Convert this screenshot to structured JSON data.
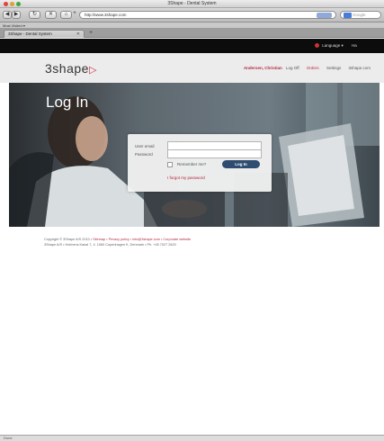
{
  "window": {
    "title": "3Shape - Dental System"
  },
  "toolbar": {
    "back": "◀",
    "forward": "▶",
    "reload": "↻",
    "stop": "✕",
    "home": "⌂",
    "add": "+",
    "url": "http://www.3shape.com",
    "search_placeholder": "Google"
  },
  "bookmarks": {
    "label": "Most Visited ▾"
  },
  "tabs": [
    {
      "label": "3Shape - Dental System"
    }
  ],
  "top_strip": {
    "language": "Language ▾",
    "help": "Ha"
  },
  "header": {
    "logo_text": "3shape",
    "logo_mark": "▷",
    "user": "Andersen, Christian",
    "logoff": "Log Off",
    "orders": "Orders",
    "settings": "Settings",
    "link": "3shape.com"
  },
  "hero": {
    "heading": "Log In"
  },
  "login_form": {
    "email_label": "User email",
    "email_value": "",
    "password_label": "Password",
    "password_value": "",
    "remember_label": "Remember me?",
    "login_button": "Log In",
    "forgot_link": "I forgot my password"
  },
  "footer": {
    "copyright": "Copyright © 3Shape A/S 2010 •",
    "sitemap": "Sitemap",
    "sep1": " • ",
    "privacy": "Privacy policy",
    "sep2": " • ",
    "email": "info@3shape.com",
    "sep3": " • ",
    "corporate": "Corporate website",
    "line2": "3Shape A/S • Holmens Kanal 7, 4. 1060 Copenhagen K, Denmark • Ph. +45 7027 2620"
  },
  "statusbar": {
    "text": "Done"
  },
  "colors": {
    "accent": "#b32940",
    "button": "#2f4d71"
  }
}
